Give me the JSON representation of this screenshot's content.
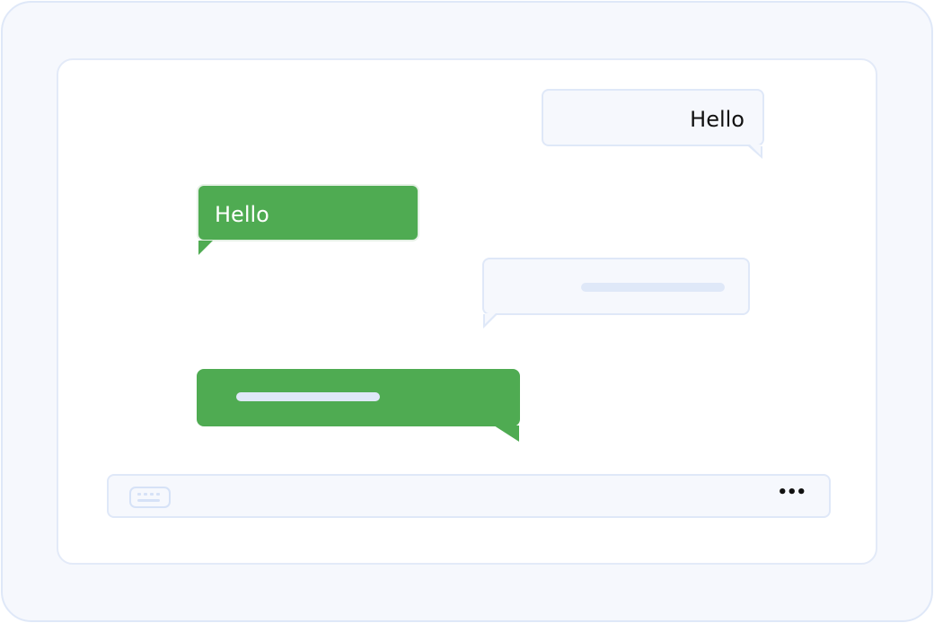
{
  "messages": [
    {
      "side": "right",
      "sender": "woman",
      "text": "Hello"
    },
    {
      "side": "left",
      "sender": "hooded-user",
      "text": "Hello"
    },
    {
      "side": "right",
      "sender": "woman",
      "text": ""
    },
    {
      "side": "left",
      "sender": "hooded-user",
      "text": ""
    }
  ],
  "composer": {
    "keyboard_icon": "keyboard-icon",
    "more_label": "•••"
  },
  "colors": {
    "outgoing_bubble": "#f6f8fd",
    "incoming_bubble": "#4fab52",
    "border": "#dfe8f8"
  }
}
